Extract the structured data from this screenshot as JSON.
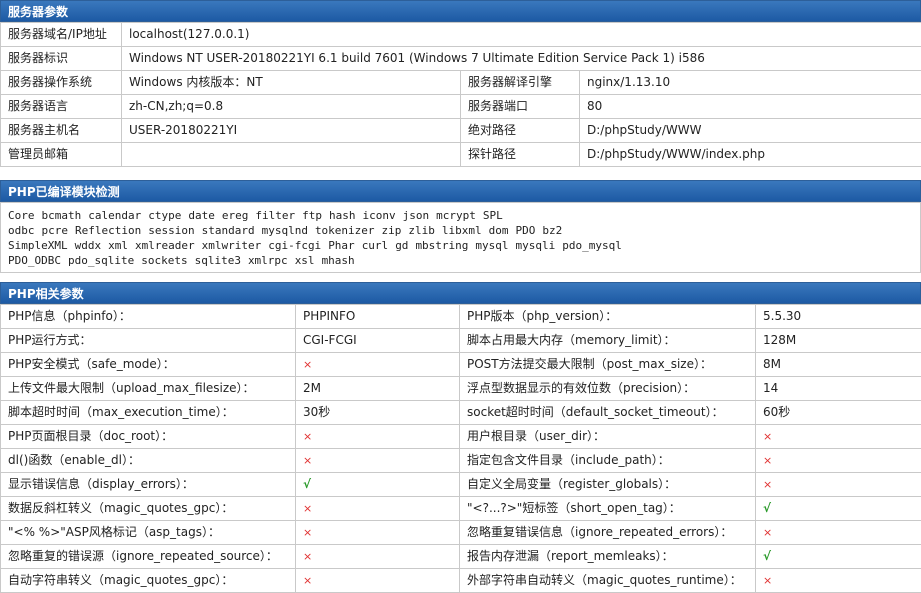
{
  "server": {
    "title": "服务器参数",
    "rows": [
      {
        "label": "服务器域名/IP地址",
        "value": "localhost(127.0.0.1)"
      },
      {
        "label": "服务器标识",
        "value": "Windows NT USER-20180221YI 6.1 build 7601 (Windows 7 Ultimate Edition Service Pack 1) i586"
      },
      {
        "label": "服务器操作系统",
        "value": "Windows  内核版本：NT",
        "label2": "服务器解译引擎",
        "value2": "nginx/1.13.10"
      },
      {
        "label": "服务器语言",
        "value": "zh-CN,zh;q=0.8",
        "label2": "服务器端口",
        "value2": "80"
      },
      {
        "label": "服务器主机名",
        "value": "USER-20180221YI",
        "label2": "绝对路径",
        "value2": "D:/phpStudy/WWW"
      },
      {
        "label": "管理员邮箱",
        "value": "",
        "label2": "探针路径",
        "value2": "D:/phpStudy/WWW/index.php"
      }
    ]
  },
  "modules": {
    "title": "PHP已编译模块检测",
    "items": [
      "Core",
      "bcmath",
      "calendar",
      "ctype",
      "date",
      "ereg",
      "filter",
      "ftp",
      "hash",
      "iconv",
      "json",
      "mcrypt",
      "SPL",
      "odbc",
      "pcre",
      "Reflection",
      "session",
      "standard",
      "mysqlnd",
      "tokenizer",
      "zip",
      "zlib",
      "libxml",
      "dom",
      "PDO",
      "bz2",
      "SimpleXML",
      "wddx",
      "xml",
      "xmlreader",
      "xmlwriter",
      "cgi-fcgi",
      "Phar",
      "curl",
      "gd",
      "mbstring",
      "mysql",
      "mysqli",
      "pdo_mysql",
      "PDO_ODBC",
      "pdo_sqlite",
      "sockets",
      "sqlite3",
      "xmlrpc",
      "xsl",
      "mhash"
    ],
    "lines": [
      13,
      13,
      13,
      7
    ]
  },
  "php": {
    "title": "PHP相关参数",
    "rows": [
      {
        "l1": "PHP信息（phpinfo）：",
        "v1": "PHPINFO",
        "l2": "PHP版本（php_version）：",
        "v2": "5.5.30"
      },
      {
        "l1": "PHP运行方式：",
        "v1": "CGI-FCGI",
        "l2": "脚本占用最大内存（memory_limit）：",
        "v2": "128M"
      },
      {
        "l1": "PHP安全模式（safe_mode）：",
        "v1": "×",
        "l2": "POST方法提交最大限制（post_max_size）：",
        "v2": "8M"
      },
      {
        "l1": "上传文件最大限制（upload_max_filesize）：",
        "v1": "2M",
        "l2": "浮点型数据显示的有效位数（precision）：",
        "v2": "14"
      },
      {
        "l1": "脚本超时时间（max_execution_time）：",
        "v1": "30秒",
        "l2": "socket超时时间（default_socket_timeout）：",
        "v2": "60秒"
      },
      {
        "l1": "PHP页面根目录（doc_root）：",
        "v1": "×",
        "l2": "用户根目录（user_dir）：",
        "v2": "×"
      },
      {
        "l1": "dl()函数（enable_dl）：",
        "v1": "×",
        "l2": "指定包含文件目录（include_path）：",
        "v2": "×"
      },
      {
        "l1": "显示错误信息（display_errors）：",
        "v1": "√",
        "l2": "自定义全局变量（register_globals）：",
        "v2": "×"
      },
      {
        "l1": "数据反斜杠转义（magic_quotes_gpc）：",
        "v1": "×",
        "l2": "\"<?...?>\"短标签（short_open_tag）：",
        "v2": "√"
      },
      {
        "l1": "\"<% %>\"ASP风格标记（asp_tags）：",
        "v1": "×",
        "l2": "忽略重复错误信息（ignore_repeated_errors）：",
        "v2": "×"
      },
      {
        "l1": "忽略重复的错误源（ignore_repeated_source）：",
        "v1": "×",
        "l2": "报告内存泄漏（report_memleaks）：",
        "v2": "√"
      },
      {
        "l1": "自动字符串转义（magic_quotes_gpc）：",
        "v1": "×",
        "l2": "外部字符串自动转义（magic_quotes_runtime）：",
        "v2": "×"
      }
    ]
  }
}
